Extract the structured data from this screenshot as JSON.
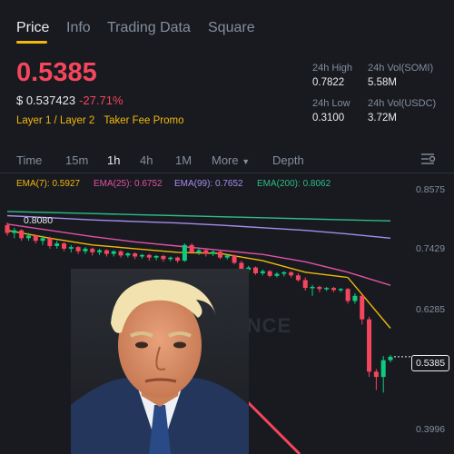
{
  "tabs": [
    "Price",
    "Info",
    "Trading Data",
    "Square"
  ],
  "price": "0.5385",
  "usd_price": "$ 0.537423",
  "change": "-27.71%",
  "tags": [
    "Layer 1 / Layer 2",
    "Taker Fee Promo"
  ],
  "stats": {
    "high_label": "24h High",
    "high": "0.7822",
    "vol_somi_label": "24h Vol(SOMI)",
    "vol_somi": "5.58M",
    "low_label": "24h Low",
    "low": "0.3100",
    "vol_usdc_label": "24h Vol(USDC)",
    "vol_usdc": "3.72M"
  },
  "intervals": [
    "Time",
    "15m",
    "1h",
    "4h",
    "1M",
    "More",
    "Depth"
  ],
  "active_interval": "1h",
  "ema": {
    "ema7": "EMA(7): 0.5927",
    "ema25": "EMA(25): 0.6752",
    "ema99": "EMA(99): 0.7652",
    "ema200": "EMA(200): 0.8062"
  },
  "axis": {
    "p1": "0.8575",
    "p2": "0.7429",
    "p3": "0.6285",
    "p4": "0.3996",
    "last_tag": "0.5385"
  },
  "chart_label_left": "0.8080",
  "watermark": "NANCE",
  "colors": {
    "up": "#0ecb81",
    "down": "#f6465d",
    "accent": "#f0b90b",
    "ema7": "#f0b90b",
    "ema25": "#e052a2",
    "ema99": "#a58dec",
    "ema200": "#2ebd85"
  },
  "chart_data": {
    "type": "candlestick",
    "ylim": [
      0.3996,
      0.8575
    ],
    "candles_ohlc": [
      [
        0.79,
        0.795,
        0.77,
        0.775
      ],
      [
        0.775,
        0.785,
        0.765,
        0.78
      ],
      [
        0.78,
        0.782,
        0.76,
        0.765
      ],
      [
        0.765,
        0.775,
        0.76,
        0.77
      ],
      [
        0.77,
        0.772,
        0.755,
        0.76
      ],
      [
        0.76,
        0.77,
        0.752,
        0.765
      ],
      [
        0.765,
        0.768,
        0.745,
        0.75
      ],
      [
        0.75,
        0.76,
        0.745,
        0.755
      ],
      [
        0.755,
        0.757,
        0.74,
        0.745
      ],
      [
        0.745,
        0.752,
        0.738,
        0.748
      ],
      [
        0.748,
        0.75,
        0.735,
        0.74
      ],
      [
        0.74,
        0.748,
        0.735,
        0.745
      ],
      [
        0.745,
        0.747,
        0.732,
        0.738
      ],
      [
        0.738,
        0.745,
        0.733,
        0.742
      ],
      [
        0.742,
        0.744,
        0.73,
        0.735
      ],
      [
        0.735,
        0.742,
        0.73,
        0.74
      ],
      [
        0.74,
        0.742,
        0.728,
        0.732
      ],
      [
        0.732,
        0.738,
        0.728,
        0.736
      ],
      [
        0.736,
        0.738,
        0.725,
        0.73
      ],
      [
        0.73,
        0.735,
        0.726,
        0.733
      ],
      [
        0.733,
        0.735,
        0.722,
        0.728
      ],
      [
        0.728,
        0.733,
        0.723,
        0.731
      ],
      [
        0.731,
        0.733,
        0.72,
        0.725
      ],
      [
        0.725,
        0.73,
        0.721,
        0.728
      ],
      [
        0.728,
        0.73,
        0.718,
        0.722
      ],
      [
        0.722,
        0.755,
        0.72,
        0.752
      ],
      [
        0.752,
        0.755,
        0.735,
        0.738
      ],
      [
        0.738,
        0.745,
        0.733,
        0.742
      ],
      [
        0.742,
        0.744,
        0.73,
        0.735
      ],
      [
        0.735,
        0.742,
        0.731,
        0.739
      ],
      [
        0.739,
        0.741,
        0.725,
        0.728
      ],
      [
        0.728,
        0.735,
        0.724,
        0.732
      ],
      [
        0.732,
        0.734,
        0.715,
        0.718
      ],
      [
        0.718,
        0.722,
        0.7,
        0.705
      ],
      [
        0.705,
        0.712,
        0.7,
        0.709
      ],
      [
        0.709,
        0.711,
        0.695,
        0.698
      ],
      [
        0.698,
        0.705,
        0.694,
        0.702
      ],
      [
        0.702,
        0.704,
        0.69,
        0.693
      ],
      [
        0.693,
        0.7,
        0.69,
        0.697
      ],
      [
        0.697,
        0.702,
        0.692,
        0.7
      ],
      [
        0.7,
        0.702,
        0.69,
        0.694
      ],
      [
        0.694,
        0.698,
        0.682,
        0.685
      ],
      [
        0.685,
        0.69,
        0.665,
        0.67
      ],
      [
        0.67,
        0.676,
        0.655,
        0.672
      ],
      [
        0.672,
        0.674,
        0.662,
        0.668
      ],
      [
        0.668,
        0.672,
        0.664,
        0.67
      ],
      [
        0.67,
        0.672,
        0.662,
        0.666
      ],
      [
        0.666,
        0.67,
        0.662,
        0.668
      ],
      [
        0.668,
        0.67,
        0.64,
        0.645
      ],
      [
        0.645,
        0.66,
        0.64,
        0.655
      ],
      [
        0.655,
        0.657,
        0.6,
        0.61
      ],
      [
        0.61,
        0.615,
        0.5,
        0.51
      ],
      [
        0.51,
        0.515,
        0.475,
        0.5
      ],
      [
        0.5,
        0.54,
        0.47,
        0.532
      ],
      [
        0.532,
        0.542,
        0.528,
        0.5385
      ]
    ],
    "ema_lines": [
      {
        "name": "EMA(200)",
        "values": [
          0.816,
          0.814,
          0.812,
          0.81,
          0.808,
          0.806,
          0.804,
          0.802,
          0.8,
          0.798
        ]
      },
      {
        "name": "EMA(99)",
        "values": [
          0.808,
          0.804,
          0.8,
          0.797,
          0.794,
          0.79,
          0.785,
          0.78,
          0.773,
          0.765
        ]
      },
      {
        "name": "EMA(25)",
        "values": [
          0.792,
          0.78,
          0.768,
          0.758,
          0.75,
          0.742,
          0.734,
          0.72,
          0.7,
          0.675
        ]
      },
      {
        "name": "EMA(7)",
        "values": [
          0.78,
          0.765,
          0.752,
          0.745,
          0.738,
          0.736,
          0.722,
          0.7,
          0.69,
          0.593
        ]
      }
    ]
  }
}
